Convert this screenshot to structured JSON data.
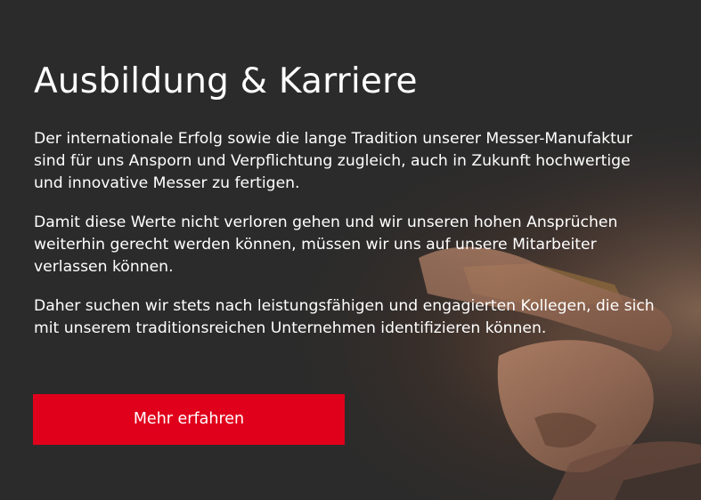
{
  "section": {
    "headline": "Ausbildung & Karriere",
    "paragraphs": [
      "Der internationale Erfolg sowie die lange Tradition unserer Messer-Manufaktur\nsind für uns Ansporn und Verpflichtung zugleich, auch in Zukunft hochwertige\nund innovative Messer zu fertigen.",
      "Damit diese Werte nicht verloren gehen und wir unseren hohen Ansprüchen\nweiterhin gerecht werden können, müssen wir uns auf unsere Mitarbeiter\nverlassen können.",
      "Daher suchen wir stets nach leistungsfähigen und engagierten Kollegen, die sich\nmit unserem traditionsreichen Unternehmen identifizieren können."
    ],
    "cta_label": "Mehr erfahren"
  },
  "colors": {
    "background": "#2b2b2b",
    "text": "#ffffff",
    "accent": "#e0001b"
  }
}
